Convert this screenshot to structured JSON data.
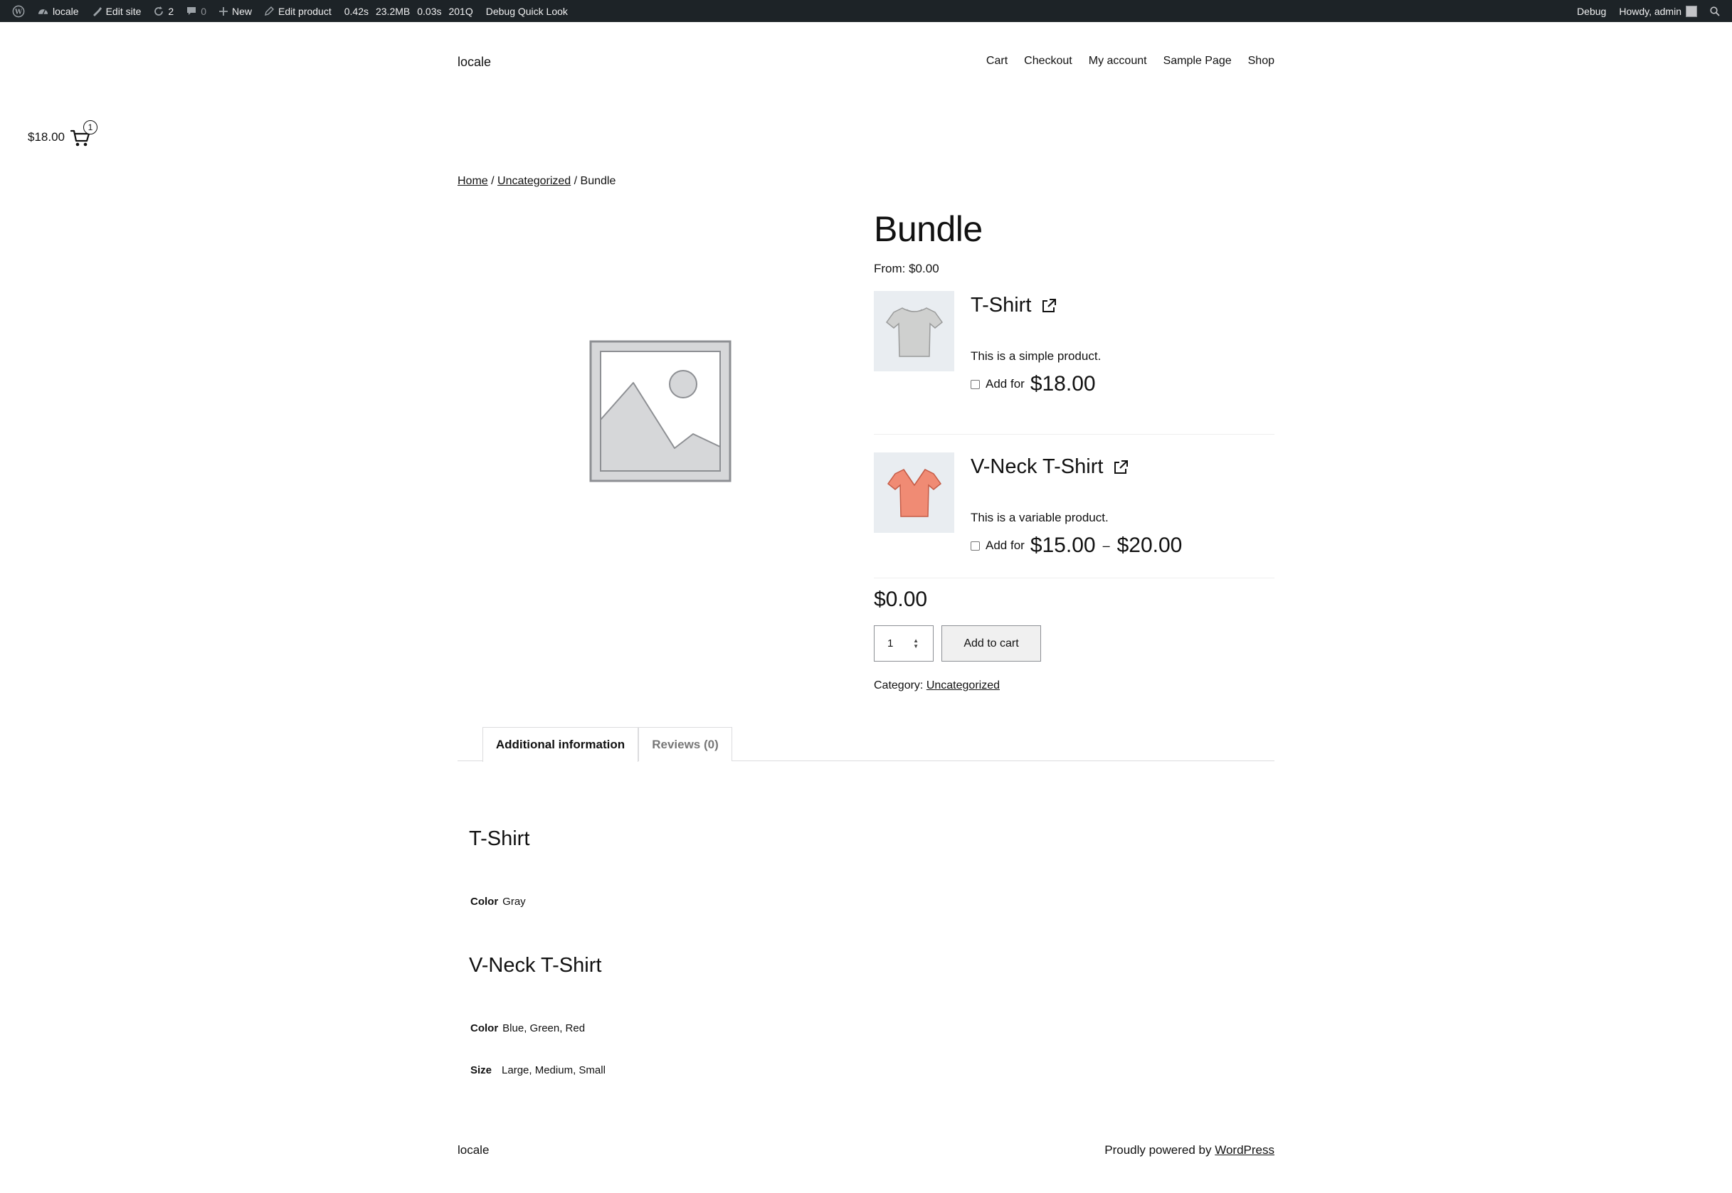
{
  "adminbar": {
    "site": "locale",
    "edit_site": "Edit site",
    "updates": "2",
    "comments": "0",
    "new": "New",
    "edit_product": "Edit product",
    "qm_time": "0.42s",
    "qm_memory": "23.2MB",
    "qm_db_time": "0.03s",
    "qm_queries": "201Q",
    "debug_quick_look": "Debug Quick Look",
    "debug": "Debug",
    "howdy": "Howdy, admin"
  },
  "header": {
    "site_title": "locale",
    "nav": [
      "Cart",
      "Checkout",
      "My account",
      "Sample Page",
      "Shop"
    ]
  },
  "minicart": {
    "total": "$18.00",
    "count": "1"
  },
  "breadcrumb": {
    "home": "Home",
    "category": "Uncategorized",
    "sep": " / ",
    "current": "Bundle"
  },
  "product": {
    "title": "Bundle",
    "from_price": "From: $0.00",
    "items": [
      {
        "title": "T-Shirt",
        "description": "This is a simple product.",
        "add_label": "Add for",
        "price": "$18.00"
      },
      {
        "title": "V-Neck T-Shirt",
        "description": "This is a variable product.",
        "add_label": "Add for",
        "price_min": "$15.00",
        "price_sep": "–",
        "price_max": "$20.00"
      }
    ],
    "total_price": "$0.00",
    "quantity": "1",
    "add_to_cart": "Add to cart",
    "category_label": "Category:",
    "category": "Uncategorized",
    "colors": {
      "tshirt": "#cfd0cf",
      "vneck": "#f08b74",
      "thumb_bg": "#e9edf1"
    }
  },
  "tabs": [
    {
      "label": "Additional information",
      "active": true
    },
    {
      "label": "Reviews (0)",
      "active": false
    }
  ],
  "additional_info": {
    "tshirt_heading": "T-Shirt",
    "tshirt_color_label": "Color",
    "tshirt_color_value": "Gray",
    "vneck_heading": "V-Neck T-Shirt",
    "vneck_color_label": "Color",
    "vneck_color_value": "Blue, Green, Red",
    "vneck_size_label": "Size",
    "vneck_size_value": "Large, Medium, Small"
  },
  "footer": {
    "site": "locale",
    "powered_by": "Proudly powered by",
    "wordpress": "WordPress"
  }
}
